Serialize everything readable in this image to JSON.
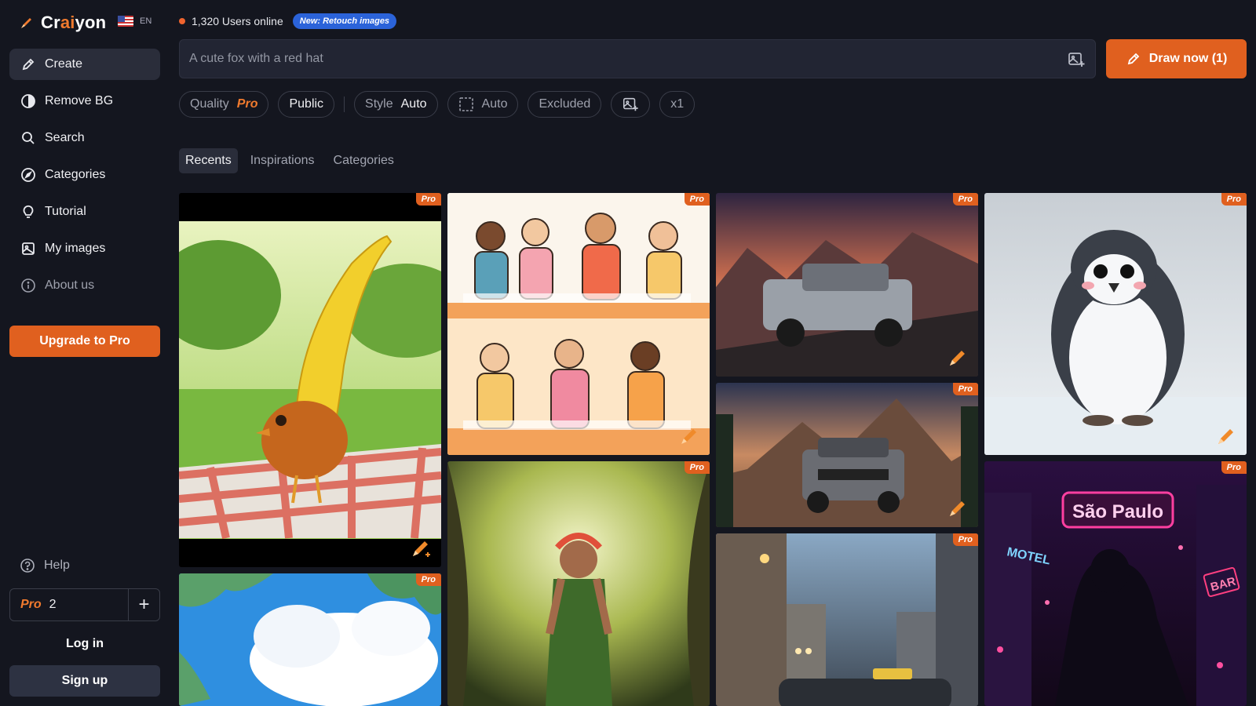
{
  "brand": {
    "name_pre": "Cr",
    "name_ai": "ai",
    "name_post": "yon",
    "lang": "EN",
    "accent": "#e0601f"
  },
  "sidebar": {
    "items": [
      {
        "label": "Create",
        "icon": "pencil-icon"
      },
      {
        "label": "Remove BG",
        "icon": "half-circle-icon"
      },
      {
        "label": "Search",
        "icon": "search-icon"
      },
      {
        "label": "Categories",
        "icon": "compass-icon"
      },
      {
        "label": "Tutorial",
        "icon": "lightbulb-icon"
      },
      {
        "label": "My images",
        "icon": "image-icon"
      },
      {
        "label": "About us",
        "icon": "info-icon"
      }
    ],
    "upgrade_label": "Upgrade to Pro",
    "help_label": "Help",
    "credits": {
      "pro_label": "Pro",
      "count": "2",
      "add": "+"
    },
    "login_label": "Log in",
    "signup_label": "Sign up"
  },
  "header": {
    "online_text": "1,320 Users online",
    "new_badge": "New: Retouch images"
  },
  "prompt": {
    "placeholder": "A cute fox with a red hat"
  },
  "draw_button": "Draw now (1)",
  "options": {
    "quality_label": "Quality",
    "quality_value": "Pro",
    "visibility": "Public",
    "style_label": "Style",
    "style_value": "Auto",
    "aspect_value": "Auto",
    "excluded_label": "Excluded",
    "count_value": "x1"
  },
  "tabs": [
    "Recents",
    "Inspirations",
    "Categories"
  ],
  "gallery": {
    "badge": "Pro",
    "tiles": [
      {
        "subject": "banana-bird-picnic"
      },
      {
        "subject": "cartoon-students-reading"
      },
      {
        "subject": "silver-pickup-truck-sunset"
      },
      {
        "subject": "penguin-on-ice"
      },
      {
        "subject": "truck-mountain-road"
      },
      {
        "subject": "forest-goddess"
      },
      {
        "subject": "sao-paulo-neon-street"
      },
      {
        "subject": "anime-sky-clouds"
      },
      {
        "subject": "city-street-taxi"
      }
    ],
    "neon_sign": "São Paulo",
    "neon_motel": "MOTEL",
    "neon_bar": "BAR"
  }
}
